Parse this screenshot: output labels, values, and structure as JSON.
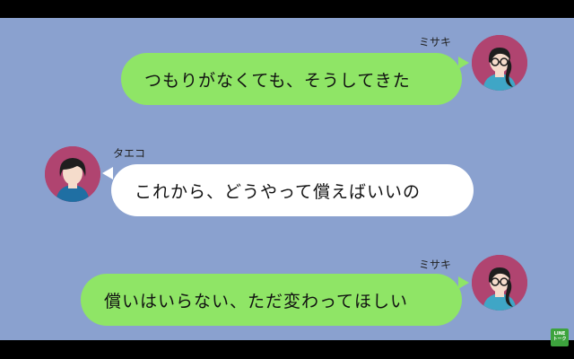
{
  "messages": [
    {
      "sender": "ミサキ",
      "side": "right",
      "text": "つもりがなくても、そうしてきた"
    },
    {
      "sender": "タエコ",
      "side": "left",
      "text": "これから、どうやって償えばいいの"
    },
    {
      "sender": "ミサキ",
      "side": "right",
      "text": "償いはいらない、ただ変わってほしい"
    }
  ],
  "logo": {
    "line1": "LINE",
    "line2": "トーク"
  },
  "colors": {
    "background": "#8aa1cf",
    "outgoing_bubble": "#8fe566",
    "incoming_bubble": "#ffffff",
    "avatar_bg": "#b04470"
  }
}
